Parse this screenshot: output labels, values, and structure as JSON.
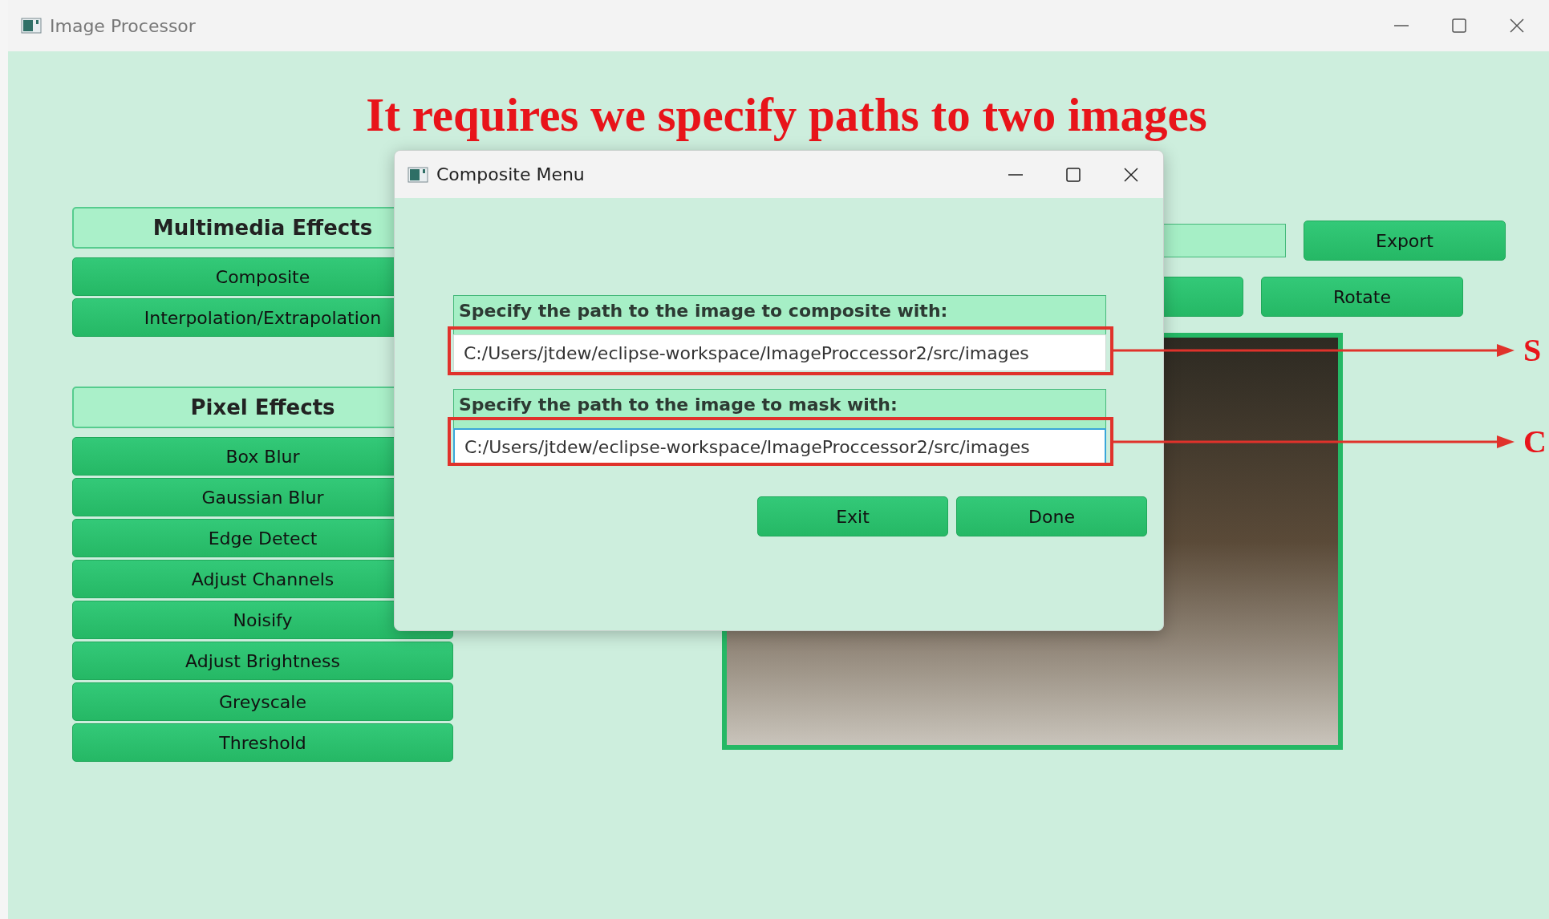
{
  "window": {
    "title": "Image Processor"
  },
  "heading": "It requires we specify paths to two images",
  "sidebar": [
    {
      "title": "Multimedia Effects",
      "items": [
        "Composite",
        "Interpolation/Extrapolation"
      ]
    },
    {
      "title": "Pixel Effects",
      "items": [
        "Box Blur",
        "Gaussian Blur",
        "Edge Detect",
        "Adjust Channels",
        "Noisify",
        "Adjust Brightness",
        "Greyscale",
        "Threshold"
      ]
    }
  ],
  "toolbar": {
    "export_button": "Export",
    "rotate_button": "Rotate"
  },
  "dialog": {
    "title": "Composite Menu",
    "fields": [
      {
        "label": "Specify the path to the image to composite with:",
        "value": "C:/Users/jtdew/eclipse-workspace/ImageProccessor2/src/images",
        "focused": false
      },
      {
        "label": "Specify the path to the image to mask with:",
        "value": "C:/Users/jtdew/eclipse-workspace/ImageProccessor2/src/images",
        "focused": true
      }
    ],
    "buttons": [
      "Exit",
      "Done"
    ]
  },
  "annotations": [
    {
      "letter": "S"
    },
    {
      "letter": "C"
    }
  ]
}
